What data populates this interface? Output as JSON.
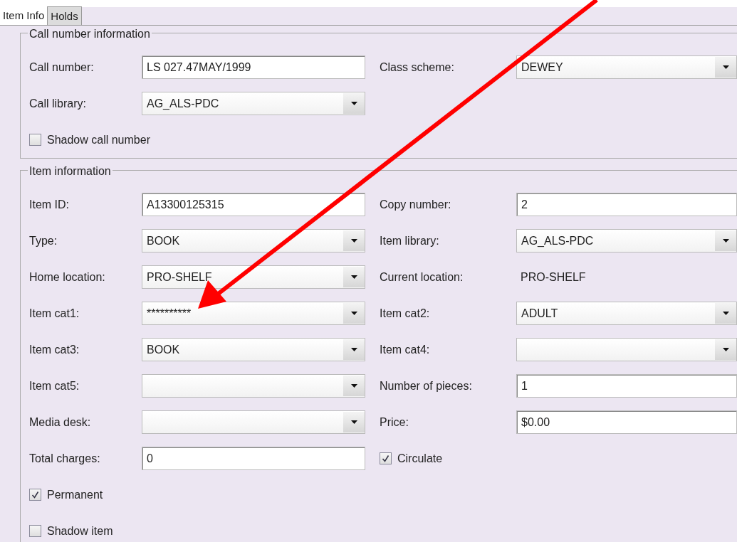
{
  "tabs": [
    {
      "label": "Item Info",
      "selected": true
    },
    {
      "label": "Holds",
      "selected": false
    }
  ],
  "groups": [
    {
      "title": "Call number information",
      "rows": [
        [
          {
            "kind": "text",
            "label": "Call number:",
            "value": "LS 027.47MAY/1999"
          },
          {
            "kind": "select",
            "label": "Class scheme:",
            "value": "DEWEY"
          }
        ],
        [
          {
            "kind": "select",
            "label": "Call library:",
            "value": "AG_ALS-PDC"
          }
        ],
        [
          {
            "kind": "checkbox",
            "label": "Shadow call number",
            "checked": false
          }
        ]
      ]
    },
    {
      "title": "Item information",
      "rows": [
        [
          {
            "kind": "text",
            "label": "Item ID:",
            "value": "A13300125315"
          },
          {
            "kind": "text",
            "label": "Copy number:",
            "value": "2"
          }
        ],
        [
          {
            "kind": "select",
            "label": "Type:",
            "value": "BOOK"
          },
          {
            "kind": "select",
            "label": "Item library:",
            "value": "AG_ALS-PDC"
          }
        ],
        [
          {
            "kind": "select",
            "label": "Home location:",
            "value": "PRO-SHELF"
          },
          {
            "kind": "static",
            "label": "Current location:",
            "value": "PRO-SHELF"
          }
        ],
        [
          {
            "kind": "select",
            "label": "Item cat1:",
            "value": "**********"
          },
          {
            "kind": "select",
            "label": "Item cat2:",
            "value": "ADULT"
          }
        ],
        [
          {
            "kind": "select",
            "label": "Item cat3:",
            "value": "BOOK"
          },
          {
            "kind": "select",
            "label": "Item cat4:"
          }
        ],
        [
          {
            "kind": "select",
            "label": "Item cat5:"
          },
          {
            "kind": "text",
            "label": "Number of pieces:",
            "value": "1"
          }
        ],
        [
          {
            "kind": "select",
            "label": "Media desk:"
          },
          {
            "kind": "text",
            "label": "Price:",
            "value": "$0.00"
          }
        ],
        [
          {
            "kind": "text",
            "label": "Total charges:",
            "value": "0"
          },
          {
            "kind": "checkbox",
            "label": "Circulate",
            "checked": true
          }
        ],
        [
          {
            "kind": "checkbox",
            "label": "Permanent",
            "checked": true
          }
        ],
        [
          {
            "kind": "checkbox",
            "label": "Shadow item",
            "checked": false
          }
        ]
      ]
    }
  ]
}
